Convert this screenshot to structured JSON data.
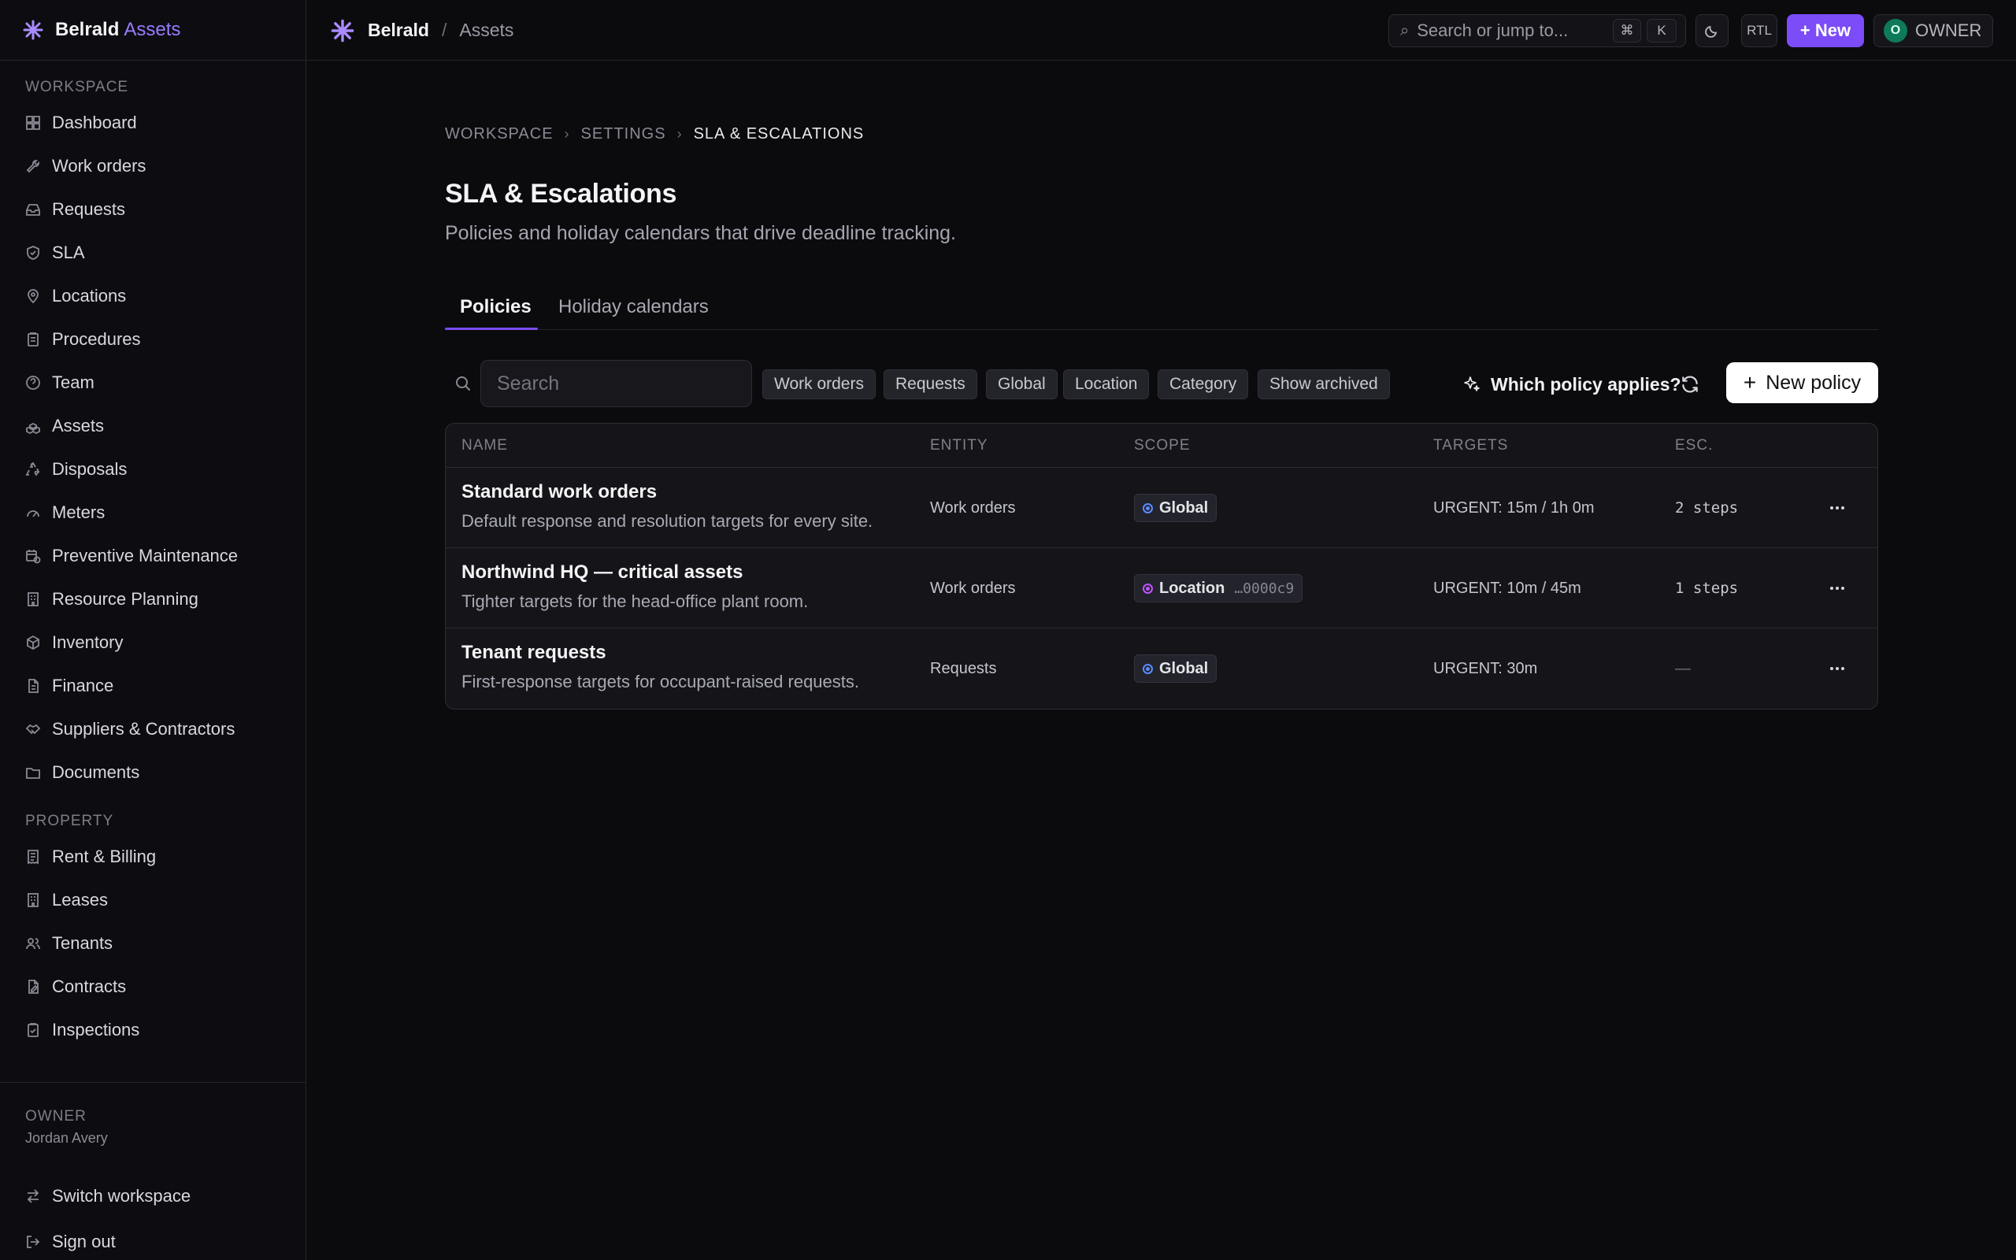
{
  "brand": {
    "name": "Belrald",
    "accent": "Assets"
  },
  "topbar": {
    "workspace": "Belrald",
    "separator": "/",
    "page": "Assets",
    "search_placeholder": "Search or jump to...",
    "kbd_cmd": "⌘",
    "kbd_k": "K",
    "rtl_label": "RTL",
    "new_label": "+ New",
    "owner_initial": "O",
    "owner_label": "OWNER"
  },
  "sidebar": {
    "workspace_label": "WORKSPACE",
    "workspace_items": [
      {
        "label": "Dashboard",
        "icon": "dashboard-icon"
      },
      {
        "label": "Work orders",
        "icon": "wrench-icon"
      },
      {
        "label": "Requests",
        "icon": "inbox-icon"
      },
      {
        "label": "SLA",
        "icon": "shield-icon"
      },
      {
        "label": "Locations",
        "icon": "map-pin-icon"
      },
      {
        "label": "Procedures",
        "icon": "clipboard-icon"
      },
      {
        "label": "Team",
        "icon": "help-circle-icon"
      },
      {
        "label": "Assets",
        "icon": "boxes-icon"
      },
      {
        "label": "Disposals",
        "icon": "recycle-icon"
      },
      {
        "label": "Meters",
        "icon": "gauge-icon"
      },
      {
        "label": "Preventive Maintenance",
        "icon": "calendar-clock-icon"
      },
      {
        "label": "Resource Planning",
        "icon": "building-icon"
      },
      {
        "label": "Inventory",
        "icon": "package-icon"
      },
      {
        "label": "Finance",
        "icon": "file-icon"
      },
      {
        "label": "Suppliers & Contractors",
        "icon": "handshake-icon"
      },
      {
        "label": "Documents",
        "icon": "folder-icon"
      }
    ],
    "property_label": "PROPERTY",
    "property_items": [
      {
        "label": "Rent & Billing",
        "icon": "receipt-icon"
      },
      {
        "label": "Leases",
        "icon": "building-icon"
      },
      {
        "label": "Tenants",
        "icon": "users-icon"
      },
      {
        "label": "Contracts",
        "icon": "file-pen-icon"
      },
      {
        "label": "Inspections",
        "icon": "clipboard-check-icon"
      }
    ],
    "footer": {
      "role": "OWNER",
      "user": "Jordan Avery",
      "switch_label": "Switch workspace",
      "signout_label": "Sign out"
    }
  },
  "breadcrumb": [
    "WORKSPACE",
    "SETTINGS",
    "SLA & ESCALATIONS"
  ],
  "page": {
    "title": "SLA & Escalations",
    "subtitle": "Policies and holiday calendars that drive deadline tracking."
  },
  "tabs": [
    {
      "label": "Policies",
      "active": true
    },
    {
      "label": "Holiday calendars",
      "active": false
    }
  ],
  "filters": {
    "search_placeholder": "Search",
    "chips": [
      "Work orders",
      "Requests",
      "Global",
      "Location",
      "Category",
      "Show archived"
    ],
    "which_label": "Which policy applies?",
    "new_policy_label": "New policy"
  },
  "table": {
    "columns": [
      "NAME",
      "ENTITY",
      "SCOPE",
      "TARGETS",
      "ESC."
    ],
    "rows": [
      {
        "name": "Standard work orders",
        "description": "Default response and resolution targets for every site.",
        "entity": "Work orders",
        "scope": "Global",
        "scope_id": "",
        "targets": "URGENT: 15m / 1h 0m",
        "esc": "2 steps"
      },
      {
        "name": "Northwind HQ — critical assets",
        "description": "Tighter targets for the head-office plant room.",
        "entity": "Work orders",
        "scope": "Location",
        "scope_id": "…0000c9",
        "targets": "URGENT: 10m / 45m",
        "esc": "1 steps"
      },
      {
        "name": "Tenant requests",
        "description": "First-response targets for occupant-raised requests.",
        "entity": "Requests",
        "scope": "Global",
        "scope_id": "",
        "targets": "URGENT: 30m",
        "esc": "—"
      }
    ]
  },
  "colors": {
    "accent": "#7b4cf7",
    "background": "#0b0b0e",
    "global_dot": "#5b8cff",
    "location_dot": "#c154ff"
  }
}
